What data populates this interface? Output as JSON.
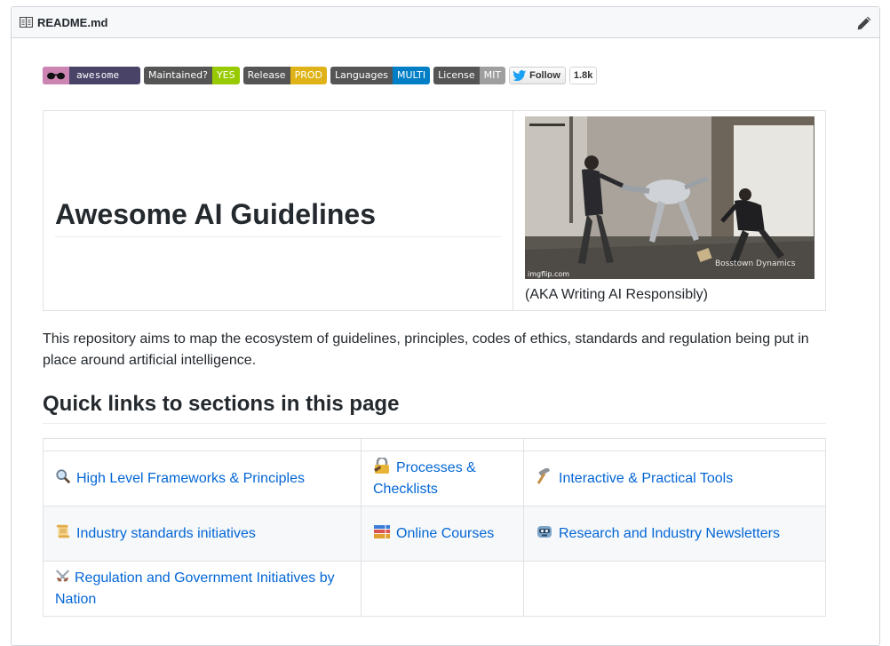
{
  "file": {
    "name": "README.md"
  },
  "badges": [
    {
      "label": "",
      "value": "awesome",
      "value_color": "#494368"
    },
    {
      "label": "Maintained?",
      "value": "YES",
      "value_color": "#97ca00"
    },
    {
      "label": "Release",
      "value": "PROD",
      "value_color": "#dfb317"
    },
    {
      "label": "Languages",
      "value": "MULTI",
      "value_color": "#007ec6"
    },
    {
      "label": "License",
      "value": "MIT",
      "value_color": "#9f9f9f"
    }
  ],
  "twitter": {
    "follow_label": "Follow",
    "count": "1.8k"
  },
  "hero": {
    "title": "Awesome AI Guidelines",
    "gif_watermark_left": "imgflip.com",
    "gif_watermark_right": "Bosstown Dynamics",
    "caption": "(AKA Writing AI Responsibly)"
  },
  "intro": "This repository aims to map the ecosystem of guidelines, principles, codes of ethics, standards and regulation being put in place around artificial intelligence.",
  "quick_links": {
    "heading": "Quick links to sections in this page",
    "rows": [
      [
        {
          "icon": "magnifier-icon",
          "label": "High Level Frameworks & Principles"
        },
        {
          "icon": "lock-icon",
          "label": "Processes & Checklists"
        },
        {
          "icon": "hammer-icon",
          "label": "Interactive & Practical Tools"
        }
      ],
      [
        {
          "icon": "scroll-icon",
          "label": "Industry standards initiatives"
        },
        {
          "icon": "books-icon",
          "label": "Online Courses"
        },
        {
          "icon": "robot-icon",
          "label": "Research and Industry Newsletters"
        }
      ],
      [
        {
          "icon": "crossed-swords-icon",
          "label": "Regulation and Government Initiatives by Nation"
        }
      ]
    ]
  },
  "colors": {
    "link": "#0366d6",
    "border": "#dfe2e5",
    "header_bg": "#f6f8fa"
  }
}
